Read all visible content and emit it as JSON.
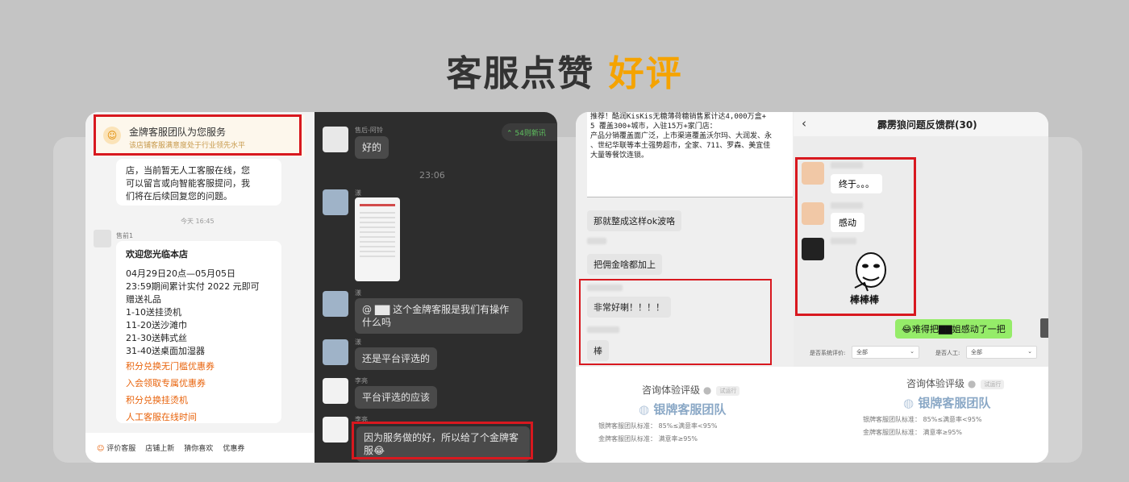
{
  "title": {
    "main": "客服点赞",
    "highlight": "好评"
  },
  "left_card": {
    "banner": {
      "title": "金牌客服团队为您服务",
      "subtitle": "该店铺客服满意度处于行业领先水平"
    },
    "auto_reply": [
      "店，当前暂无人工客服在线，您",
      "可以留言或向智能客服提问，我",
      "们将在后续回复您的问题。"
    ],
    "time_1": "今天 16:45",
    "agent_label": "售前1",
    "welcome": {
      "title": "欢迎您光临本店",
      "lines": [
        "04月29日20点—05月05日",
        "23:59期间累计实付 2022 元即可",
        "赠送礼品",
        "1-10送挂烫机",
        "11-20送沙滩巾",
        "21-30送韩式丝",
        "31-40送桌面加湿器"
      ],
      "links": [
        "积分兑换无门槛优惠券",
        "入会领取专属优惠券",
        "积分兑换挂烫机",
        "人工客服在线时间"
      ]
    },
    "tabs": [
      "评价客服",
      "店铺上新",
      "猜你喜欢",
      "优惠券"
    ],
    "group": {
      "new_messages": "54则新讯",
      "msg1_name": "售后-阿铃",
      "msg1_text": "好的",
      "time": "23:06",
      "msg2_name": "漾",
      "msg3_name": "漾",
      "msg3_text": "@ ▇▇ 这个金牌客服是我们有操作什么吗",
      "msg4_name": "漾",
      "msg4_text": "还是平台评选的",
      "msg5_name": "李亮",
      "msg5_text": "平台评选的应该",
      "msg6_name": "李亮",
      "msg6_text": "因为服务做的好，所以给了个金牌客服😂"
    }
  },
  "right_card": {
    "notice_lines": [
      "推荐！酷润KisKis无糖薄荷糖销售累计达4,000万盒+",
      "5 覆盖300+城市，入驻15万+家门店：",
      "产品分销覆盖面广泛，上市渠道覆盖沃尔玛、大润发、永",
      "、世纪华联等本土强势超市，全家、711、罗森、美宜佳",
      "大量等餐饮连锁。"
    ],
    "left_msgs": [
      "那就整成这样ok波咯",
      "把佣金啥都加上",
      "非常好喇！！！！",
      "棒"
    ],
    "group_title": "霹雳狼问题反馈群(30)",
    "group_msgs": [
      "终于。。。",
      "感动"
    ],
    "sticker_text": "棒棒棒",
    "green_msg": "😂难得把▇▇姐感动了一把",
    "filters": [
      {
        "label": "是否系统评价:",
        "value": "全部"
      },
      {
        "label": "是否人工:",
        "value": "全部"
      }
    ],
    "stats": [
      {
        "title": "咨询体验评级",
        "badge": "试运行",
        "team": "银牌客服团队",
        "line1": "银牌客服团队标准：  85%≤满意率<95%",
        "line2": "金牌客服团队标准：  满意率≥95%"
      },
      {
        "title": "咨询体验评级",
        "badge": "试运行",
        "team": "银牌客服团队",
        "line1": "银牌客服团队标准：  85%≤满意率<95%",
        "line2": "金牌客服团队标准：  满意率≥95%"
      }
    ]
  },
  "colors": {
    "accent": "#f5a300",
    "highlight_box": "#d8181f",
    "wechat_green": "#95ec69"
  }
}
